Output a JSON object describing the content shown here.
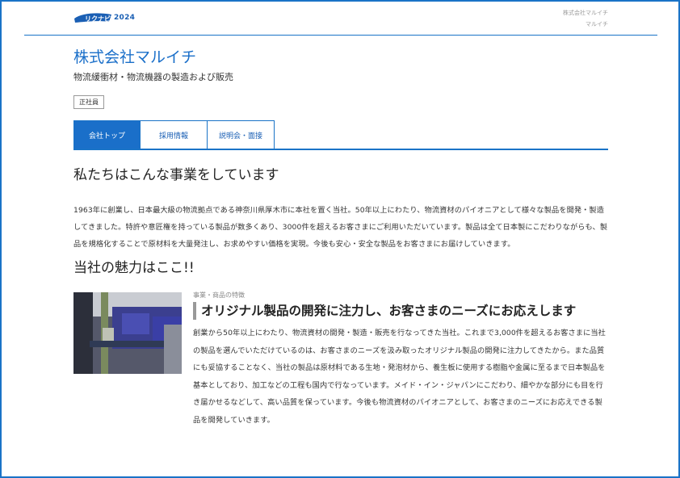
{
  "header": {
    "logo_year": "2024",
    "right_line1": "株式会社マルイチ",
    "right_line2": "マルイチ"
  },
  "company": {
    "name": "株式会社マルイチ",
    "description": "物流緩衝材・物流機器の製造および販売",
    "employment_badge": "正社員"
  },
  "tabs": [
    {
      "label": "会社トップ",
      "active": true
    },
    {
      "label": "採用情報",
      "active": false
    },
    {
      "label": "説明会・面接",
      "active": false
    }
  ],
  "business": {
    "heading": "私たちはこんな事業をしています",
    "text": "1963年に創業し、日本最大級の物流拠点である神奈川県厚木市に本社を置く当社。50年以上にわたり、物流資材のパイオニアとして様々な製品を開発・製造してきました。特許や意匠権を持っている製品が数多くあり、3000件を超えるお客さまにご利用いただいています。製品は全て日本製にこだわりながらも、製品を規格化することで原材料を大量発注し、お求めやすい価格を実現。今後も安心・安全な製品をお客さまにお届けしていきます。"
  },
  "appeal": {
    "heading": "当社の魅力はここ!!",
    "category": "事業・商品の特徴",
    "title": "オリジナル製品の開発に注力し、お客さまのニーズにお応えします",
    "text": "創業から50年以上にわたり、物流資材の開発・製造・販売を行なってきた当社。これまで3,000件を超えるお客さまに当社の製品を選んでいただけているのは、お客さまのニーズを汲み取ったオリジナル製品の開発に注力してきたから。また品質にも妥協することなく、当社の製品は原材料である生地・発泡材から、養生板に使用する樹脂や金属に至るまで日本製品を基本としており、加工などの工程も国内で行なっています。メイド・イン・ジャパンにこだわり、細やかな部分にも目を行き届かせるなどして、高い品質を保っています。今後も物流資材のパイオニアとして、お客さまのニーズにお応えできる製品を開発していきます。"
  },
  "colors": {
    "brand_blue": "#1a6fc9",
    "border_blue": "#1a73c7"
  }
}
